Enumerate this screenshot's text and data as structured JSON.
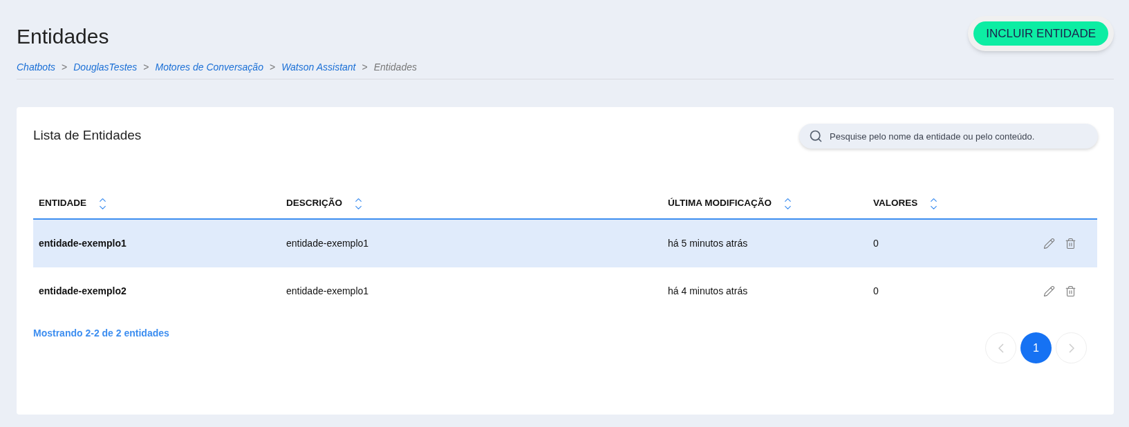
{
  "page": {
    "title": "Entidades",
    "action_button": "INCLUIR ENTIDADE"
  },
  "breadcrumb": [
    {
      "label": "Chatbots",
      "current": false
    },
    {
      "label": "DouglasTestes",
      "current": false
    },
    {
      "label": "Motores de Conversação",
      "current": false
    },
    {
      "label": "Watson Assistant",
      "current": false
    },
    {
      "label": "Entidades",
      "current": true
    }
  ],
  "breadcrumb_separator": ">",
  "card": {
    "title": "Lista de Entidades",
    "search": {
      "placeholder": "Pesquise pelo nome da entidade ou pelo conteúdo."
    }
  },
  "table": {
    "columns": [
      "ENTIDADE",
      "DESCRIÇÃO",
      "ÚLTIMA MODIFICAÇÃO",
      "VALORES"
    ],
    "rows": [
      {
        "cells": [
          "entidade-exemplo1",
          "entidade-exemplo1",
          "há 5 minutos atrás",
          "0"
        ],
        "highlighted": true
      },
      {
        "cells": [
          "entidade-exemplo2",
          "entidade-exemplo1",
          "há 4 minutos atrás",
          "0"
        ],
        "highlighted": false
      }
    ]
  },
  "footer": {
    "summary": "Mostrando 2-2 de 2 entidades"
  },
  "pagination": {
    "prev_disabled": true,
    "next_disabled": true,
    "pages": [
      {
        "label": "1",
        "selected": true
      }
    ]
  }
}
